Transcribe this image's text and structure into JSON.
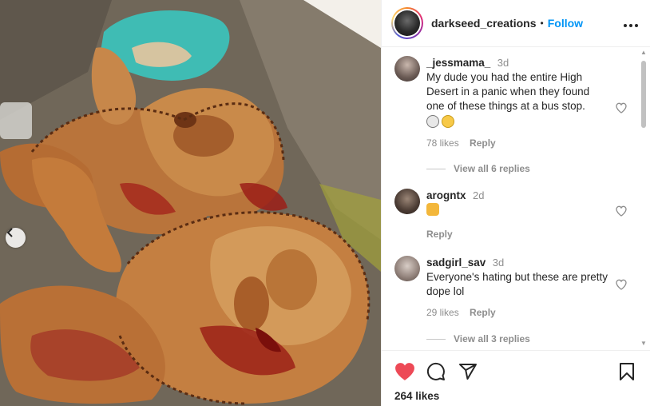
{
  "post": {
    "username": "darkseed_creations",
    "separator": "•",
    "follow_label": "Follow",
    "more_label": "•••"
  },
  "comments": [
    {
      "username": "_jessmama_",
      "time": "3d",
      "text": "My dude you had the entire High Desert in a panic when they found one of these things at a bus stop.",
      "emojis": [
        "skull",
        "grinning-sweat"
      ],
      "likes": "78 likes",
      "reply_label": "Reply",
      "view_replies": "View all 6 replies"
    },
    {
      "username": "arogntx",
      "time": "2d",
      "text": "",
      "emojis": [
        "clapping-hands"
      ],
      "reply_label": "Reply"
    },
    {
      "username": "sadgirl_sav",
      "time": "3d",
      "text": "Everyone's hating but these are pretty dope lol",
      "likes": "29 likes",
      "reply_label": "Reply",
      "view_replies": "View all 3 replies"
    }
  ],
  "footer": {
    "likes_count": "264 likes"
  },
  "colors": {
    "accent": "#0095f6",
    "like_red": "#ed4956",
    "muted": "#8e8e8e"
  }
}
